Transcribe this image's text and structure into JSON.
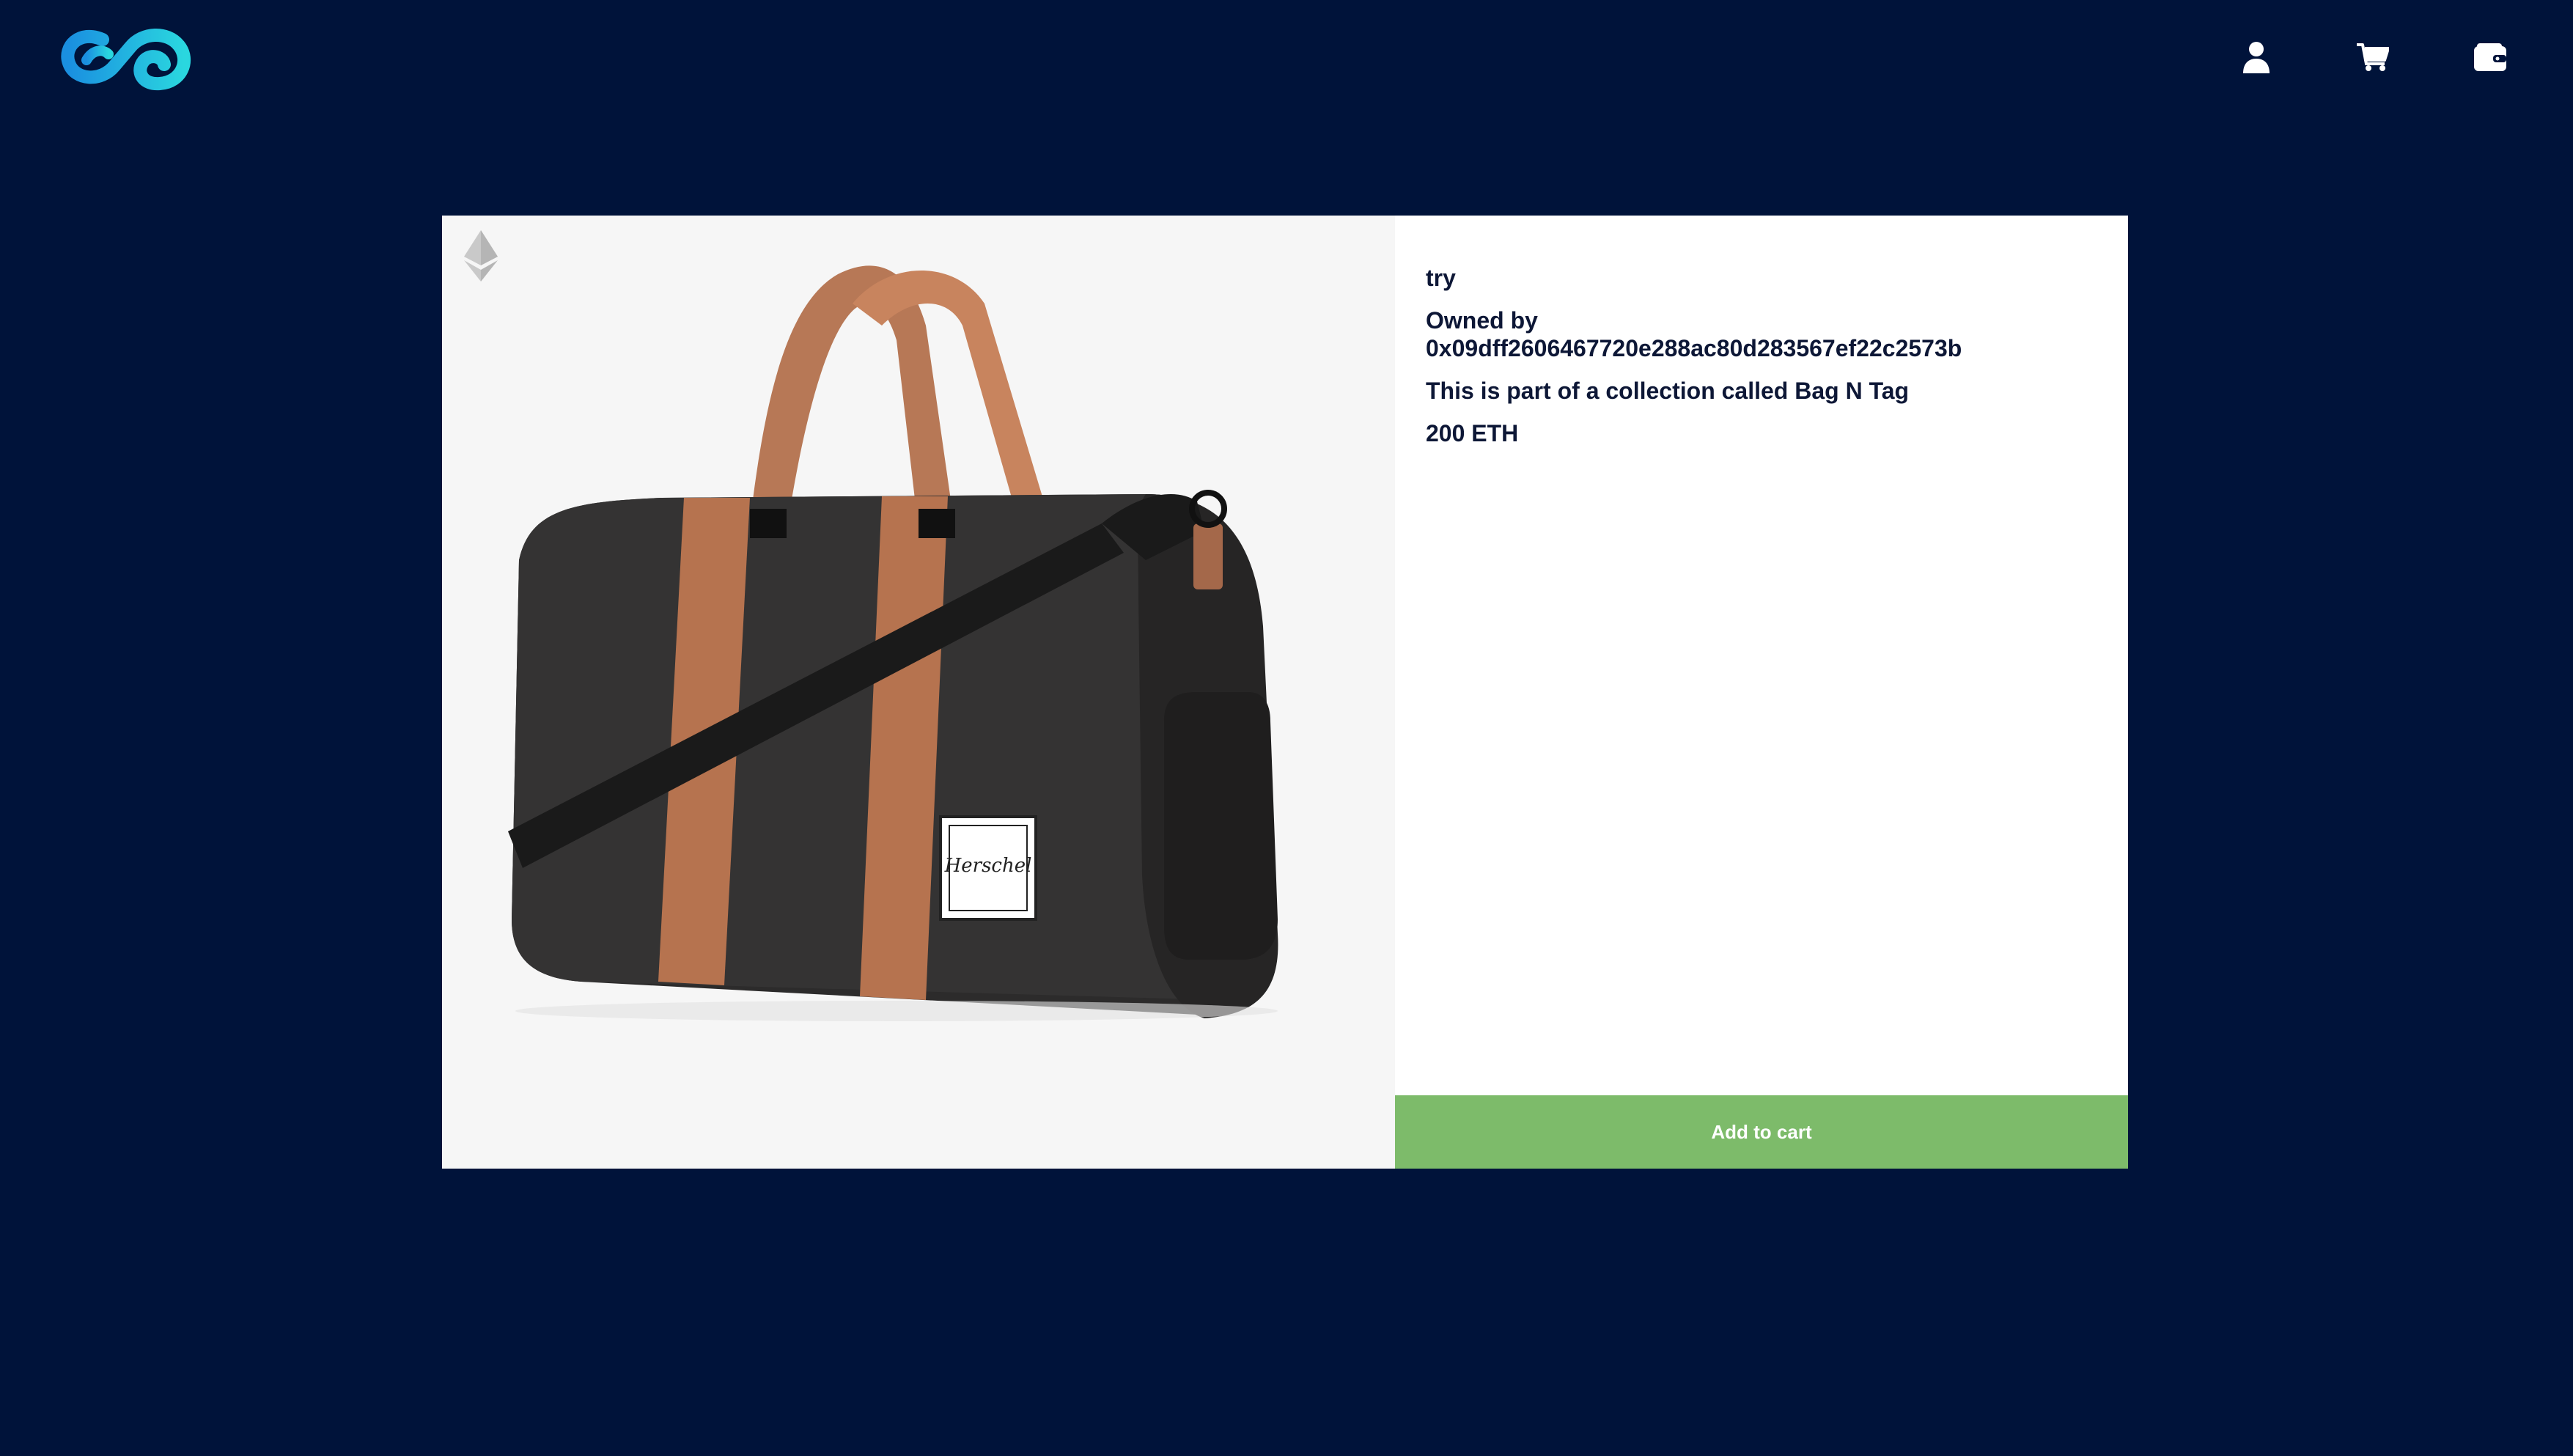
{
  "header": {
    "logo_icon": "infinity-logo-icon",
    "nav_icons": [
      "profile-icon",
      "cart-icon",
      "wallet-icon"
    ]
  },
  "product": {
    "image_icon": "duffel-bag-image",
    "badge_icon": "ethereum-icon",
    "name": "try",
    "owned_by_label": "Owned by",
    "owner_address": "0x09dff2606467720e288ac80d283567ef22c2573b",
    "collection_text": "This is part of a collection called Bag N Tag",
    "price": "200 ETH",
    "add_to_cart_label": "Add to cart"
  },
  "colors": {
    "background": "#00133a",
    "card": "#ffffff",
    "image_bg": "#f6f6f6",
    "text": "#0d1736",
    "button": "#7dbb6a",
    "logo_gradient_start": "#1d8fe0",
    "logo_gradient_end": "#28d6e0"
  }
}
